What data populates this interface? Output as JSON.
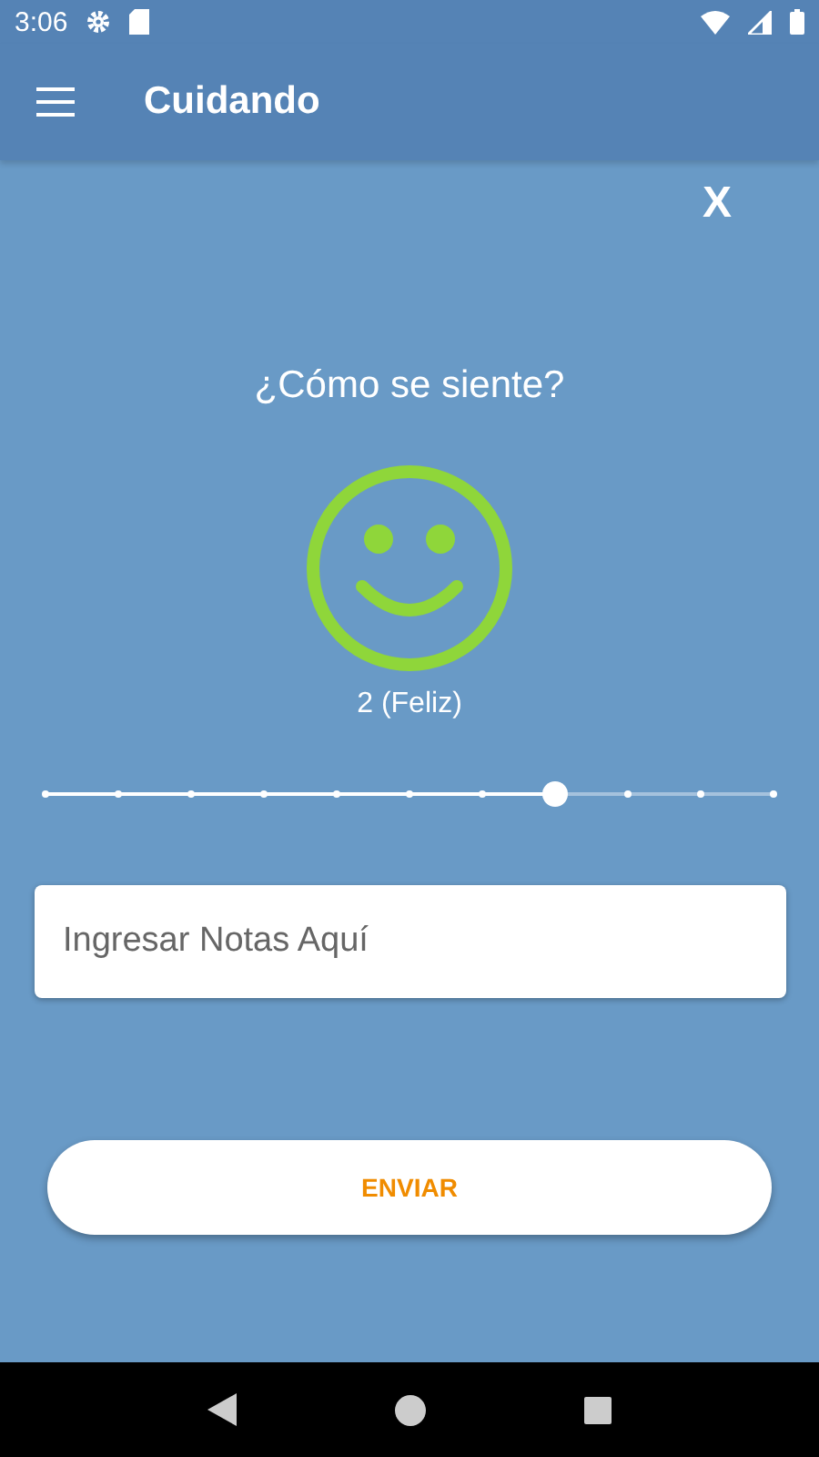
{
  "status_bar": {
    "time": "3:06"
  },
  "app_bar": {
    "title": "Cuidando"
  },
  "close_label": "X",
  "question": "¿Cómo se siente?",
  "mood_reading": "2 (Feliz)",
  "mood_slider": {
    "level": 0.7
  },
  "notes": {
    "placeholder": "Ingresar Notas Aquí"
  },
  "submit_button": "ENVIAR"
}
